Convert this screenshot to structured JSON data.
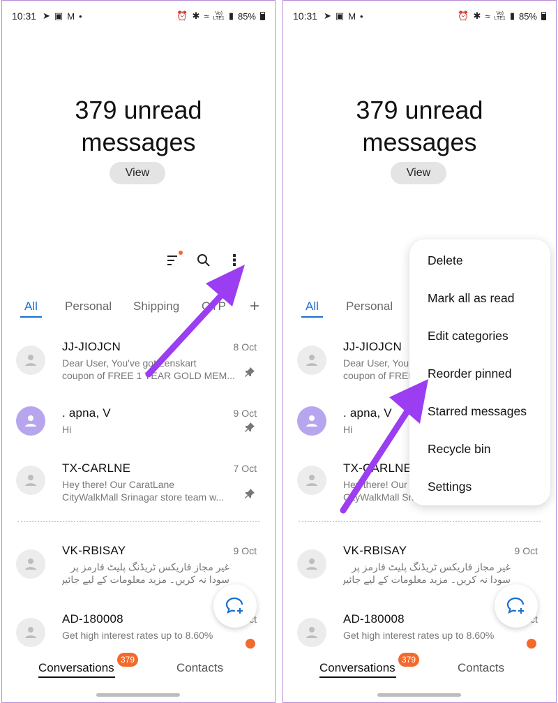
{
  "status": {
    "time": "10:31",
    "battery": "85%",
    "network": "VoLTE LTE1"
  },
  "header": {
    "unread_line1": "379 unread",
    "unread_line2": "messages",
    "view_label": "View"
  },
  "tabs": {
    "all": "All",
    "personal": "Personal",
    "shipping": "Shipping",
    "otp": "OTP"
  },
  "conversations": [
    {
      "name": "JJ-JIOJCN",
      "date": "8 Oct",
      "line1": "Dear User, You've got Lenskart",
      "line2": "coupon of FREE 1 YEAR GOLD MEM...",
      "pinned": true
    },
    {
      "name": ". apna, V",
      "date": "9 Oct",
      "line1": "Hi",
      "line2": "",
      "pinned": true
    },
    {
      "name": "TX-CARLNE",
      "date": "7 Oct",
      "line1": "Hey there! Our CaratLane",
      "line2": "CityWalkMall Srinagar store team w...",
      "pinned": true
    },
    {
      "name": "VK-RBISAY",
      "date": "9 Oct",
      "line1": "غیر مجاز فاریکس ٹریڈنگ پلیٹ فارمز پر",
      "line2": "سودا نہ کریں۔ مزید معلومات کے لیے جائیں: http",
      "pinned": false
    },
    {
      "name": "AD-180008",
      "date": "Oct",
      "line1": "Get high interest rates up to 8.60%",
      "line2": "",
      "pinned": false
    }
  ],
  "bottom_nav": {
    "conversations": "Conversations",
    "conversations_badge": "379",
    "contacts": "Contacts"
  },
  "menu": {
    "items": [
      "Delete",
      "Mark all as read",
      "Edit categories",
      "Reorder pinned",
      "Starred messages",
      "Recycle bin",
      "Settings"
    ]
  },
  "colors": {
    "accent": "#1a6fd0",
    "badge": "#f26a2c",
    "arrow": "#9b3df0",
    "frame": "#b58ad8"
  }
}
